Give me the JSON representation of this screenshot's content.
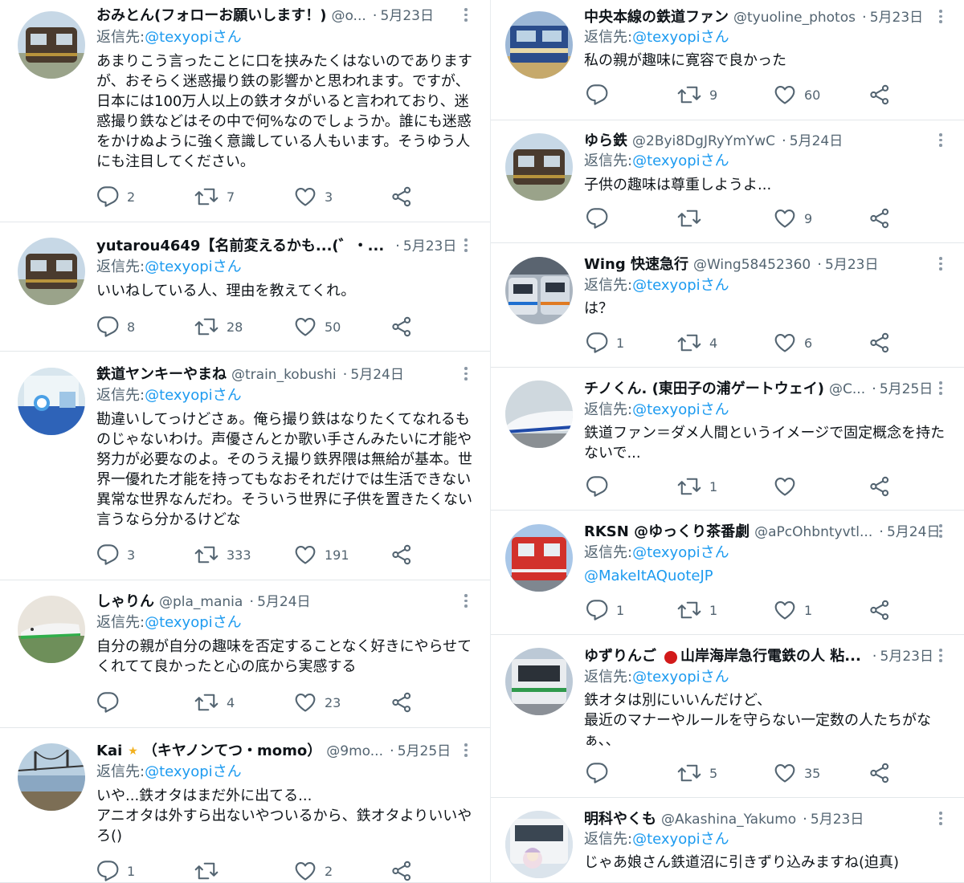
{
  "reply_prefix": "返信先:",
  "reply_to": "@texyopiさん",
  "colors": {
    "link": "#1d9bf0",
    "muted": "#536471",
    "text": "#0f1419"
  },
  "icons": [
    "comment-icon",
    "retweet-icon",
    "like-icon",
    "share-icon",
    "more-icon"
  ],
  "left_column": [
    {
      "name": "おみとん(フォローお願いします！)",
      "handle": "@o...",
      "date": "5月23日",
      "avatar": "train-photo",
      "body": "あまりこう言ったことに口を挟みたくはないのでありますが、おそらく迷惑撮り鉄の影響かと思われます。ですが、日本には100万人以上の鉄オタがいると言われており、迷惑撮り鉄などはその中で何%なのでしょうか。誰にも迷惑をかけぬように強く意識している人もいます。そうゆう人にも注目してください。",
      "replies": "2",
      "retweets": "7",
      "likes": "3"
    },
    {
      "name": "yutarou4649【名前変えるかも...(゛・...",
      "handle": "",
      "date": "5月23日",
      "avatar": "train-photo",
      "body": "いいねしている人、理由を教えてくれ。",
      "replies": "8",
      "retweets": "28",
      "likes": "50"
    },
    {
      "name": "鉄道ヤンキーやまね",
      "handle": "@train_kobushi",
      "date": "5月24日",
      "avatar": "train-interior-photo",
      "body": "勘違いしてっけどさぁ。俺ら撮り鉄はなりたくてなれるものじゃないわけ。声優さんとか歌い手さんみたいに才能や努力が必要なのよ。そのうえ撮り鉄界隈は無給が基本。世界一優れた才能を持ってもなおそれだけでは生活できない異常な世界なんだわ。そういう世界に子供を置きたくない言うなら分かるけどな",
      "replies": "3",
      "retweets": "333",
      "likes": "191"
    },
    {
      "name": "しゃりん",
      "handle": "@pla_mania",
      "date": "5月24日",
      "avatar": "shinkansen-models-photo",
      "body": "自分の親が自分の趣味を否定することなく好きにやらせてくれてて良かったと心の底から実感する",
      "replies": "",
      "retweets": "4",
      "likes": "23"
    },
    {
      "name": "Kai",
      "name_suffix": "（キヤノンてつ・momo）",
      "handle": "@9mo...",
      "date": "5月25日",
      "avatar": "bridge-photo",
      "body": "いや...鉄オタはまだ外に出てる...\nアニオタは外すら出ないやついるから、鉄オタよりいいやろ()",
      "replies": "1",
      "retweets": "",
      "likes": "2"
    }
  ],
  "right_column": [
    {
      "name": "中央本線の鉄道ファン",
      "handle": "@tyuoline_photos",
      "date": "5月23日",
      "avatar": "locomotive-photo",
      "body": "私の親が趣味に寛容で良かった",
      "replies": "",
      "retweets": "9",
      "likes": "60"
    },
    {
      "name": "ゆら鉄",
      "handle": "@2Byi8DgJRyYmYwC",
      "date": "5月24日",
      "avatar": "train-photo",
      "body": "子供の趣味は尊重しようよ...",
      "replies": "",
      "retweets": "",
      "likes": "9"
    },
    {
      "name": "Wing 快速急行",
      "handle": "@Wing58452360",
      "date": "5月23日",
      "avatar": "station-photo",
      "body": "は？",
      "replies": "1",
      "retweets": "4",
      "likes": "6"
    },
    {
      "name": "チノくん. (東田子の浦ゲートウェイ)",
      "handle": "@C...",
      "date": "5月25日",
      "avatar": "shinkansen-photo",
      "body": "鉄道ファン＝ダメ人間というイメージで固定概念を持たないで...",
      "replies": "",
      "retweets": "1",
      "likes": ""
    },
    {
      "name": "RKSN @ゆっくり茶番劇",
      "handle": "@aPcOhbntyvtl...",
      "date": "5月24日",
      "avatar": "red-train-photo",
      "body": "@MakeItAQuoteJP",
      "body_is_link": true,
      "replies": "1",
      "retweets": "1",
      "likes": "1"
    },
    {
      "name": "ゆずりんご",
      "name_suffix": "山岸海岸急行電鉄の人 粘...",
      "handle": "",
      "date": "5月23日",
      "avatar": "commuter-train-photo",
      "body": "鉄オタは別にいいんだけど、\n最近のマナーやルールを守らない一定数の人たちがなぁ、、",
      "replies": "",
      "retweets": "5",
      "likes": "35"
    },
    {
      "name": "明科やくも",
      "handle": "@Akashina_Yakumo",
      "date": "5月23日",
      "avatar": "bus-character-photo",
      "body": "じゃあ娘さん鉄道沼に引きずり込みますね(迫真)",
      "replies": "",
      "retweets": "",
      "likes": ""
    }
  ]
}
